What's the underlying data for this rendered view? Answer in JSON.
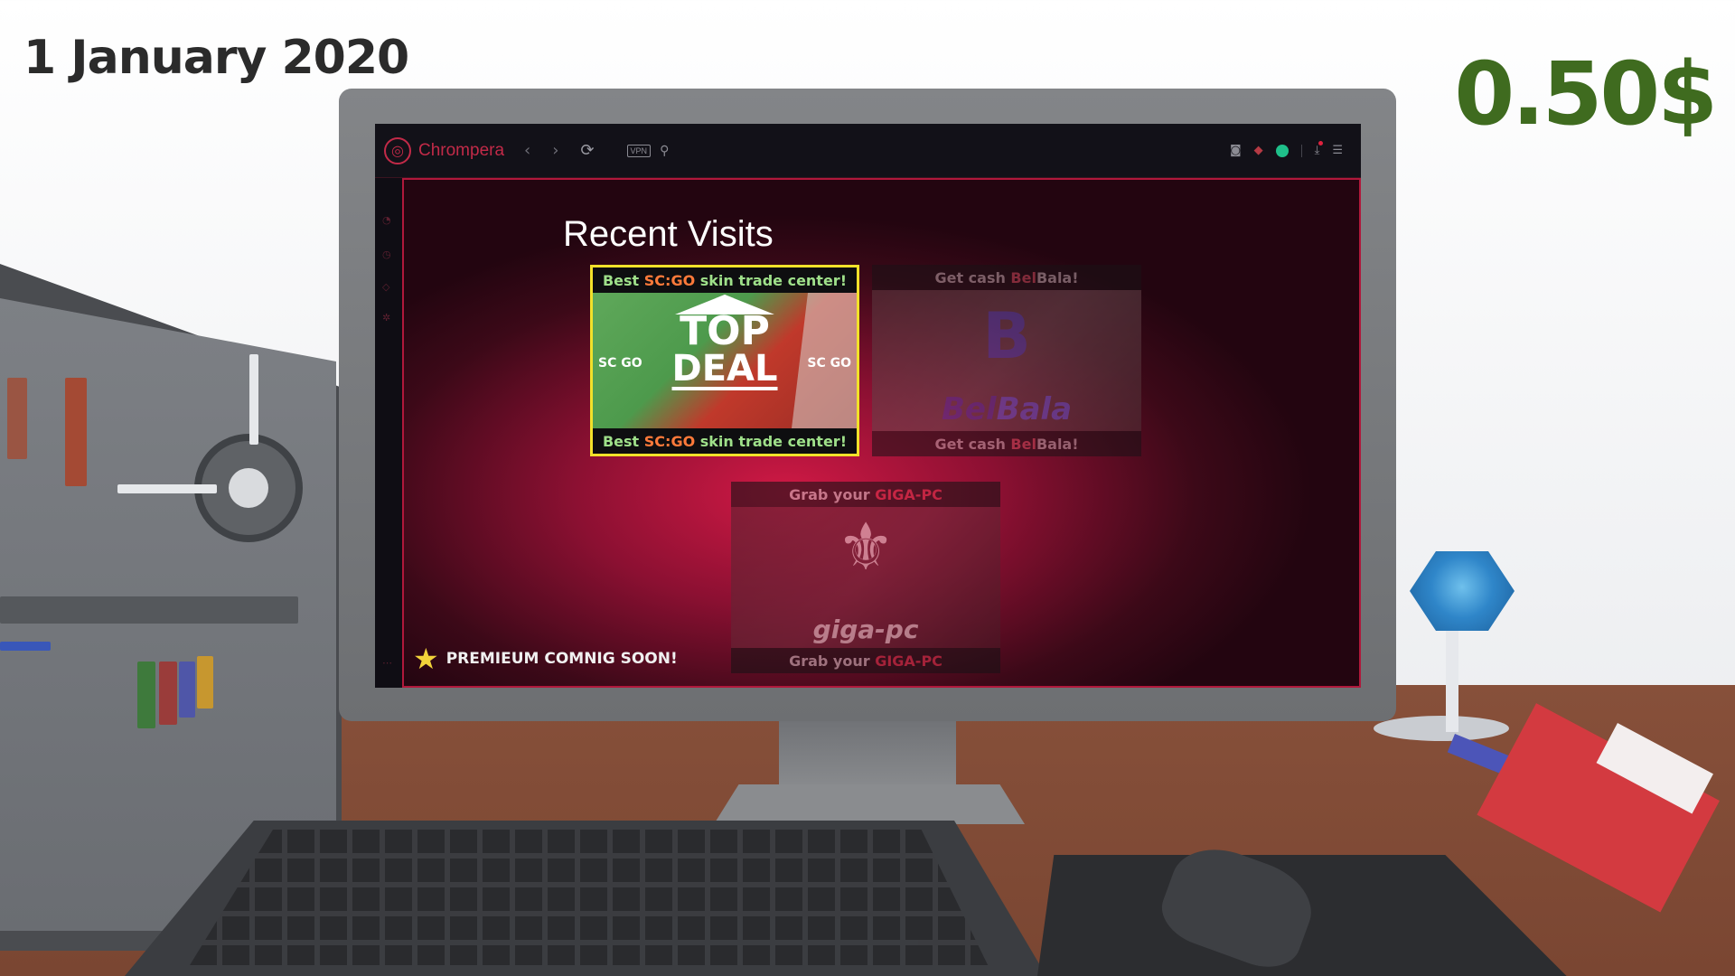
{
  "hud": {
    "date": "1 January 2020",
    "money": "0.50$"
  },
  "browser": {
    "name": "Chrompera",
    "vpn_label": "VPN",
    "icons": {
      "logo": "chrompera-logo-icon",
      "back": "chevron-left-icon",
      "forward": "chevron-right-icon",
      "reload": "reload-icon",
      "search": "search-icon",
      "camera": "camera-icon",
      "cube": "cube-icon",
      "extension": "green-circle-icon",
      "download": "download-icon",
      "settings": "sliders-icon"
    }
  },
  "content": {
    "heading": "Recent Visits",
    "tiles": [
      {
        "caption_prefix": "Best ",
        "caption_highlight": "SC:GO",
        "caption_suffix": " skin trade center!",
        "logo_small": "SC:GO",
        "logo_line1": "TOP",
        "logo_line2": "DEAL",
        "side_left": "SC GO",
        "side_right": "SC GO",
        "selected": true
      },
      {
        "caption_prefix": "Get cash ",
        "caption_highlight": "Bel",
        "caption_suffix": "Bala!",
        "logo_part1": "Bel",
        "logo_part2": "Bala",
        "selected": false
      },
      {
        "caption_prefix": "Grab your ",
        "caption_highlight": "GIGA-PC",
        "caption_suffix": "",
        "logo_text": "giga-pc",
        "selected": false
      }
    ],
    "premium_label": "PREMIEUM COMNIG SOON!"
  },
  "colors": {
    "money": "#3f6b1f",
    "brand": "#c22a48",
    "highlight_yellow": "#f2e12a",
    "caption_green": "#9fe08a",
    "caption_orange": "#ff7a3a"
  }
}
